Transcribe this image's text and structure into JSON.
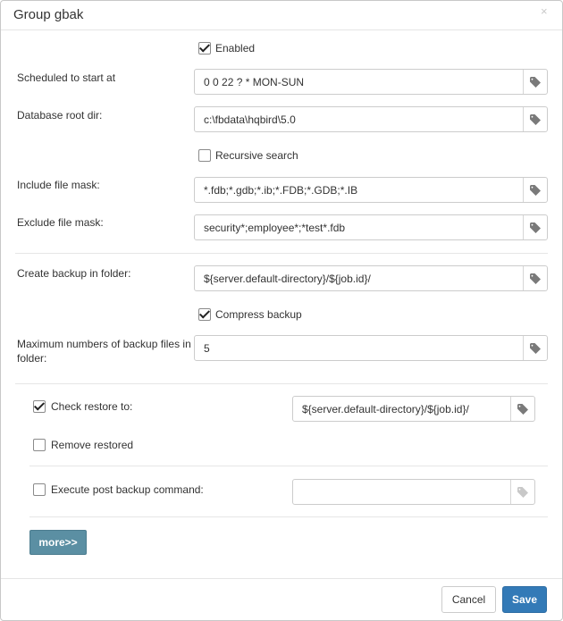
{
  "dialog": {
    "title": "Group gbak",
    "close_glyph": "×"
  },
  "form": {
    "enabled": {
      "label": "Enabled",
      "checked": true
    },
    "schedule": {
      "label": "Scheduled to start at",
      "value": "0 0 22 ? * MON-SUN"
    },
    "db_root": {
      "label": "Database root dir:",
      "value": "c:\\fbdata\\hqbird\\5.0"
    },
    "recursive": {
      "label": "Recursive search",
      "checked": false
    },
    "include_mask": {
      "label": "Include file mask:",
      "value": "*.fdb;*.gdb;*.ib;*.FDB;*.GDB;*.IB"
    },
    "exclude_mask": {
      "label": "Exclude file mask:",
      "value": "security*;employee*;*test*.fdb"
    },
    "backup_folder": {
      "label": "Create backup in folder:",
      "value": "${server.default-directory}/${job.id}/"
    },
    "compress": {
      "label": "Compress backup",
      "checked": true
    },
    "max_files": {
      "label_line1": "Maximum numbers of backup files in",
      "label_line2": "folder:",
      "value": "5"
    },
    "check_restore": {
      "label": "Check restore to:",
      "checked": true,
      "value": "${server.default-directory}/${job.id}/"
    },
    "remove_restored": {
      "label": "Remove restored",
      "checked": false
    },
    "post_command": {
      "label": "Execute post backup command:",
      "checked": false,
      "value": ""
    }
  },
  "buttons": {
    "more": "more>>",
    "cancel": "Cancel",
    "save": "Save"
  },
  "icons": {
    "field_addon": "tag-icon",
    "close": "close-icon",
    "checkbox": "checkmark-icon"
  },
  "colors": {
    "primary": "#337ab7",
    "more_button": "#5b8fa3",
    "border": "#cccccc"
  }
}
